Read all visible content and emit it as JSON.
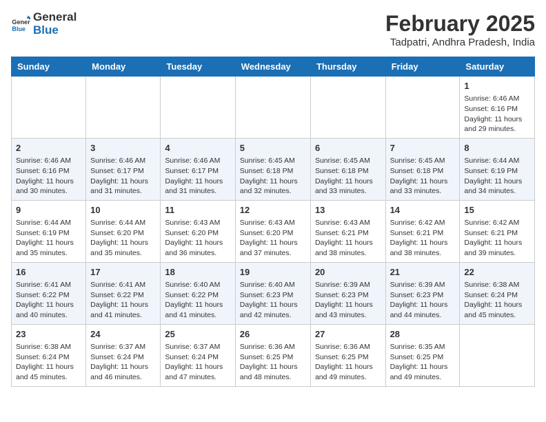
{
  "header": {
    "logo_line1": "General",
    "logo_line2": "Blue",
    "month_title": "February 2025",
    "location": "Tadpatri, Andhra Pradesh, India"
  },
  "days_of_week": [
    "Sunday",
    "Monday",
    "Tuesday",
    "Wednesday",
    "Thursday",
    "Friday",
    "Saturday"
  ],
  "weeks": [
    [
      {
        "num": "",
        "info": ""
      },
      {
        "num": "",
        "info": ""
      },
      {
        "num": "",
        "info": ""
      },
      {
        "num": "",
        "info": ""
      },
      {
        "num": "",
        "info": ""
      },
      {
        "num": "",
        "info": ""
      },
      {
        "num": "1",
        "info": "Sunrise: 6:46 AM\nSunset: 6:16 PM\nDaylight: 11 hours and 29 minutes."
      }
    ],
    [
      {
        "num": "2",
        "info": "Sunrise: 6:46 AM\nSunset: 6:16 PM\nDaylight: 11 hours and 30 minutes."
      },
      {
        "num": "3",
        "info": "Sunrise: 6:46 AM\nSunset: 6:17 PM\nDaylight: 11 hours and 31 minutes."
      },
      {
        "num": "4",
        "info": "Sunrise: 6:46 AM\nSunset: 6:17 PM\nDaylight: 11 hours and 31 minutes."
      },
      {
        "num": "5",
        "info": "Sunrise: 6:45 AM\nSunset: 6:18 PM\nDaylight: 11 hours and 32 minutes."
      },
      {
        "num": "6",
        "info": "Sunrise: 6:45 AM\nSunset: 6:18 PM\nDaylight: 11 hours and 33 minutes."
      },
      {
        "num": "7",
        "info": "Sunrise: 6:45 AM\nSunset: 6:18 PM\nDaylight: 11 hours and 33 minutes."
      },
      {
        "num": "8",
        "info": "Sunrise: 6:44 AM\nSunset: 6:19 PM\nDaylight: 11 hours and 34 minutes."
      }
    ],
    [
      {
        "num": "9",
        "info": "Sunrise: 6:44 AM\nSunset: 6:19 PM\nDaylight: 11 hours and 35 minutes."
      },
      {
        "num": "10",
        "info": "Sunrise: 6:44 AM\nSunset: 6:20 PM\nDaylight: 11 hours and 35 minutes."
      },
      {
        "num": "11",
        "info": "Sunrise: 6:43 AM\nSunset: 6:20 PM\nDaylight: 11 hours and 36 minutes."
      },
      {
        "num": "12",
        "info": "Sunrise: 6:43 AM\nSunset: 6:20 PM\nDaylight: 11 hours and 37 minutes."
      },
      {
        "num": "13",
        "info": "Sunrise: 6:43 AM\nSunset: 6:21 PM\nDaylight: 11 hours and 38 minutes."
      },
      {
        "num": "14",
        "info": "Sunrise: 6:42 AM\nSunset: 6:21 PM\nDaylight: 11 hours and 38 minutes."
      },
      {
        "num": "15",
        "info": "Sunrise: 6:42 AM\nSunset: 6:21 PM\nDaylight: 11 hours and 39 minutes."
      }
    ],
    [
      {
        "num": "16",
        "info": "Sunrise: 6:41 AM\nSunset: 6:22 PM\nDaylight: 11 hours and 40 minutes."
      },
      {
        "num": "17",
        "info": "Sunrise: 6:41 AM\nSunset: 6:22 PM\nDaylight: 11 hours and 41 minutes."
      },
      {
        "num": "18",
        "info": "Sunrise: 6:40 AM\nSunset: 6:22 PM\nDaylight: 11 hours and 41 minutes."
      },
      {
        "num": "19",
        "info": "Sunrise: 6:40 AM\nSunset: 6:23 PM\nDaylight: 11 hours and 42 minutes."
      },
      {
        "num": "20",
        "info": "Sunrise: 6:39 AM\nSunset: 6:23 PM\nDaylight: 11 hours and 43 minutes."
      },
      {
        "num": "21",
        "info": "Sunrise: 6:39 AM\nSunset: 6:23 PM\nDaylight: 11 hours and 44 minutes."
      },
      {
        "num": "22",
        "info": "Sunrise: 6:38 AM\nSunset: 6:24 PM\nDaylight: 11 hours and 45 minutes."
      }
    ],
    [
      {
        "num": "23",
        "info": "Sunrise: 6:38 AM\nSunset: 6:24 PM\nDaylight: 11 hours and 45 minutes."
      },
      {
        "num": "24",
        "info": "Sunrise: 6:37 AM\nSunset: 6:24 PM\nDaylight: 11 hours and 46 minutes."
      },
      {
        "num": "25",
        "info": "Sunrise: 6:37 AM\nSunset: 6:24 PM\nDaylight: 11 hours and 47 minutes."
      },
      {
        "num": "26",
        "info": "Sunrise: 6:36 AM\nSunset: 6:25 PM\nDaylight: 11 hours and 48 minutes."
      },
      {
        "num": "27",
        "info": "Sunrise: 6:36 AM\nSunset: 6:25 PM\nDaylight: 11 hours and 49 minutes."
      },
      {
        "num": "28",
        "info": "Sunrise: 6:35 AM\nSunset: 6:25 PM\nDaylight: 11 hours and 49 minutes."
      },
      {
        "num": "",
        "info": ""
      }
    ]
  ]
}
